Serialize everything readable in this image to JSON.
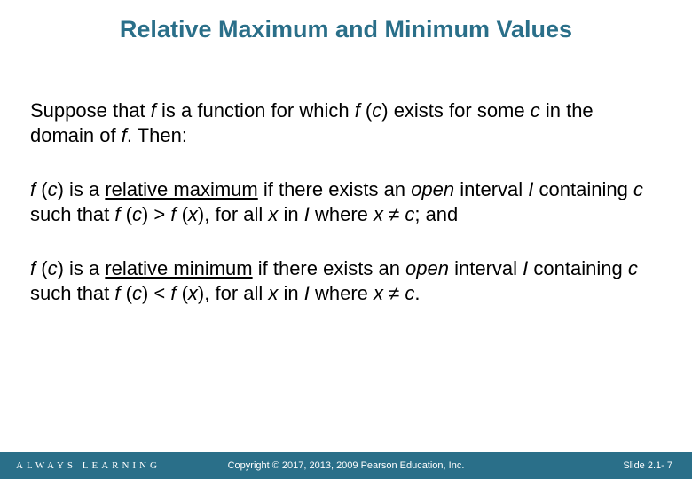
{
  "title": "Relative Maximum and Minimum Values",
  "paragraphs": {
    "p1_pre": "Suppose that ",
    "p1_f1": "f",
    "p1_mid1": " is a function for which ",
    "p1_f2": "f ",
    "p1_mid2": "(",
    "p1_c1": "c",
    "p1_mid3": ") exists for some ",
    "p1_c2": "c",
    "p1_mid4": " in the domain of ",
    "p1_f3": "f",
    "p1_end": ". Then:",
    "p2_f1": "f ",
    "p2_open": "(",
    "p2_c1": "c",
    "p2_close": ") is a ",
    "p2_relmax": "relative maximum",
    "p2_mid1": " if there exists an ",
    "p2_open_": "open",
    "p2_mid2": " interval ",
    "p2_I1": "I",
    "p2_mid3": " containing ",
    "p2_c2": "c",
    "p2_mid4": " such that ",
    "p2_f2": "f ",
    "p2_open2": "(",
    "p2_c3": "c",
    "p2_close2": ") > ",
    "p2_f3": "f ",
    "p2_open3": "(",
    "p2_x1": "x",
    "p2_close3": "), for all ",
    "p2_x2": "x",
    "p2_mid5": " in ",
    "p2_I2": "I",
    "p2_mid6": " where ",
    "p2_x3": "x",
    "p2_ne": " ≠ ",
    "p2_c4": "c",
    "p2_end": "; and",
    "p3_f1": "f ",
    "p3_open": "(",
    "p3_c1": "c",
    "p3_close": ") is a ",
    "p3_relmin": "relative minimum",
    "p3_mid1": " if there exists an ",
    "p3_open_": "open",
    "p3_mid2": " interval ",
    "p3_I1": "I",
    "p3_mid3": " containing ",
    "p3_c2": "c",
    "p3_mid4": " such that ",
    "p3_f2": "f ",
    "p3_open2": "(",
    "p3_c3": "c",
    "p3_close2": ") < ",
    "p3_f3": "f ",
    "p3_open3": "(",
    "p3_x1": "x",
    "p3_close3": "), for all ",
    "p3_x2": "x",
    "p3_mid5": " in ",
    "p3_I2": "I",
    "p3_mid6": " where ",
    "p3_x3": "x",
    "p3_ne": " ≠ ",
    "p3_c4": "c",
    "p3_end": "."
  },
  "footer": {
    "brand": "ALWAYS LEARNING",
    "copyright": "Copyright © 2017, 2013, 2009 Pearson Education, Inc.",
    "slidenum": "Slide 2.1- 7"
  }
}
